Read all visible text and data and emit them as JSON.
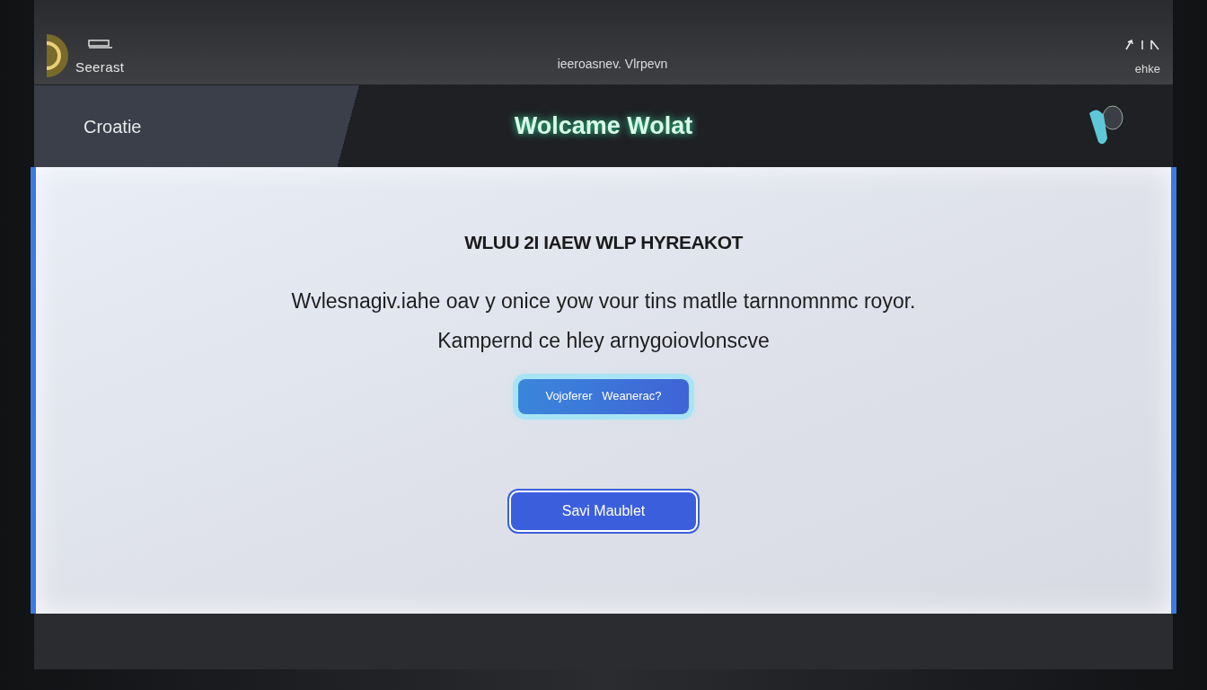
{
  "top_bar": {
    "brand": "Seerast",
    "title": "ieeroasnev. Vlrpevn",
    "status_label": "ehke"
  },
  "header": {
    "section": "Croatie",
    "welcome": "Wolcame Wolat"
  },
  "panel": {
    "heading": "WLUU 2I IAEW WLP HYREAKOT",
    "paragraph_lines": [
      "Wvlesnagiv.iahe oav y onice yow vour tins matlle tarnnomnmc royor.",
      "Kampernd ce hley arnygoiovlonscve"
    ],
    "buttons": [
      {
        "label": "Vojoferer   Weanerac?",
        "kind": "glow"
      },
      {
        "label": "Savi Maublet",
        "kind": "solid"
      }
    ]
  }
}
